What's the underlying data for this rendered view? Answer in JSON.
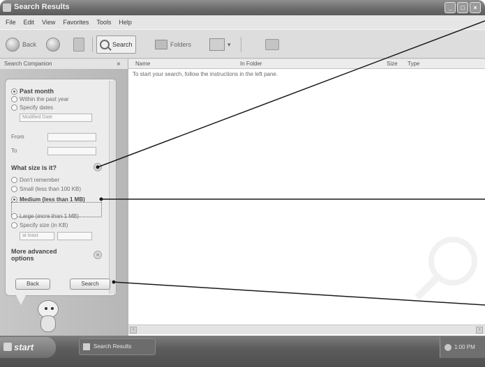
{
  "window": {
    "title": "Search Results",
    "buttons": [
      "_",
      "□",
      "×"
    ]
  },
  "menubar": {
    "items": [
      "File",
      "Edit",
      "View",
      "Favorites",
      "Tools",
      "Help"
    ]
  },
  "toolbar": {
    "back": "Back",
    "search": "Search",
    "folders": "Folders"
  },
  "left_pane": {
    "header": "Search Companion",
    "close": "×",
    "date_options": [
      "Past month",
      "Within the past year",
      "Specify dates"
    ],
    "modified_date_placeholder": "Modified Date",
    "from_label": "From",
    "to_label": "To",
    "size_heading": "What size is it?",
    "size_options": [
      "Don't remember",
      "Small (less than 100 KB)",
      "Medium (less than 1 MB)",
      "Large (more than 1 MB)",
      "Specify size (in KB)"
    ],
    "size_unit_placeholder": "at least",
    "more_options": "More advanced options",
    "back_button": "Back",
    "search_button": "Search"
  },
  "results": {
    "columns": [
      "Name",
      "In Folder",
      "Size",
      "Type"
    ],
    "hint": "To start your search, follow the instructions in the left pane."
  },
  "taskbar": {
    "start": "start",
    "task": "Search Results",
    "tray": "1:00 PM"
  }
}
